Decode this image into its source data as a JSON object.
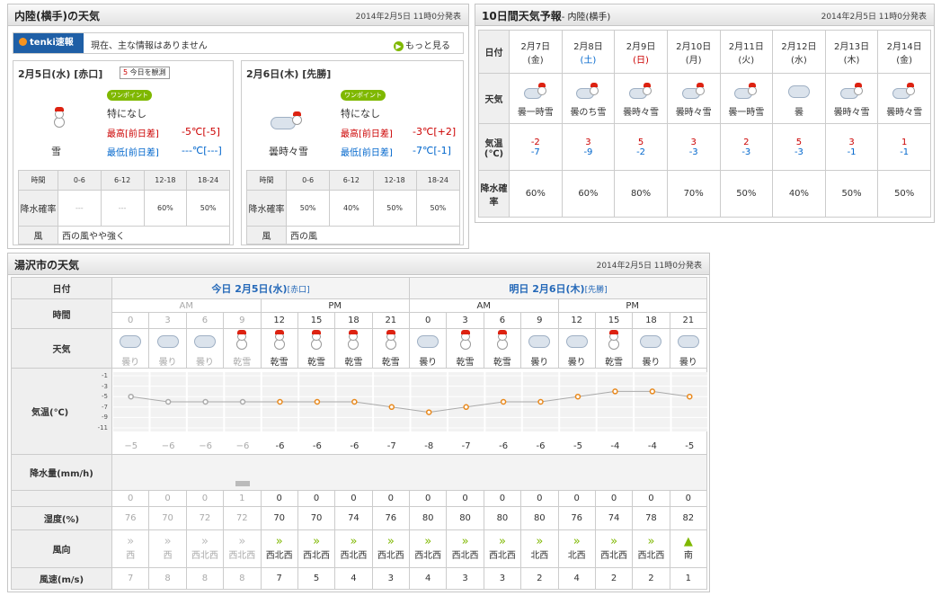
{
  "p1": {
    "title": "内陸(横手)の天気",
    "published": "2014年2月5日 11時0分発表",
    "badge": "tenki速報",
    "badge_msg": "現在、主な情報はありません",
    "more": "もっと見る",
    "days": [
      {
        "date": "2月5日(水) [赤口]",
        "tag": "今日を観測",
        "point": "ワンポイント",
        "note": "特になし",
        "weather": "雪",
        "icon": "snowman",
        "max_label": "最高[前日差]",
        "max": "-5℃[-5]",
        "min_label": "最低[前日差]",
        "min": "---℃[---]",
        "h_time": "時間",
        "slots": [
          "0-6",
          "6-12",
          "12-18",
          "18-24"
        ],
        "h_rain": "降水確率",
        "rain": [
          "---",
          "---",
          "60%",
          "50%"
        ],
        "h_wind": "風",
        "wind": "西の風やや強く"
      },
      {
        "date": "2月6日(木) [先勝]",
        "tag": "",
        "point": "ワンポイント",
        "note": "特になし",
        "weather": "曇時々雪",
        "icon": "cloud-snowman",
        "max_label": "最高[前日差]",
        "max": "-3℃[+2]",
        "min_label": "最低[前日差]",
        "min": "-7℃[-1]",
        "h_time": "時間",
        "slots": [
          "0-6",
          "6-12",
          "12-18",
          "18-24"
        ],
        "h_rain": "降水確率",
        "rain": [
          "50%",
          "40%",
          "50%",
          "50%"
        ],
        "h_wind": "風",
        "wind": "西の風"
      }
    ]
  },
  "p2": {
    "title": "10日間天気予報",
    "area": "- 内陸(横手)",
    "published": "2014年2月5日 11時0分発表",
    "labels": {
      "date": "日付",
      "weather": "天気",
      "temp": "気温(℃)",
      "rain": "降水確率"
    },
    "days": [
      {
        "d": "2月7日",
        "w": "(金)",
        "wc": "",
        "icon": "cloud-snowman",
        "weather": "曇一時雪",
        "hi": "-2",
        "lo": "-7",
        "rain": "60%"
      },
      {
        "d": "2月8日",
        "w": "(土)",
        "wc": "sat",
        "icon": "cloud-snowman",
        "weather": "曇のち雪",
        "hi": "3",
        "lo": "-9",
        "rain": "60%"
      },
      {
        "d": "2月9日",
        "w": "(日)",
        "wc": "sun",
        "icon": "cloud-snowman",
        "weather": "曇時々雪",
        "hi": "5",
        "lo": "-2",
        "rain": "80%"
      },
      {
        "d": "2月10日",
        "w": "(月)",
        "wc": "",
        "icon": "cloud-snowman",
        "weather": "曇時々雪",
        "hi": "3",
        "lo": "-3",
        "rain": "70%"
      },
      {
        "d": "2月11日",
        "w": "(火)",
        "wc": "",
        "icon": "cloud-snowman",
        "weather": "曇一時雪",
        "hi": "2",
        "lo": "-3",
        "rain": "50%"
      },
      {
        "d": "2月12日",
        "w": "(水)",
        "wc": "",
        "icon": "cloud",
        "weather": "曇",
        "hi": "5",
        "lo": "-3",
        "rain": "40%"
      },
      {
        "d": "2月13日",
        "w": "(木)",
        "wc": "",
        "icon": "cloud-snowman",
        "weather": "曇時々雪",
        "hi": "3",
        "lo": "-1",
        "rain": "50%"
      },
      {
        "d": "2月14日",
        "w": "(金)",
        "wc": "",
        "icon": "cloud-snowman",
        "weather": "曇時々雪",
        "hi": "1",
        "lo": "-1",
        "rain": "50%"
      }
    ]
  },
  "p3": {
    "title": "湯沢市の天気",
    "published": "2014年2月5日 11時0分発表",
    "labels": {
      "date": "日付",
      "time": "時間",
      "weather": "天気",
      "temp": "気温(℃)",
      "precip": "降水量(mm/h)",
      "humidity": "湿度(%)",
      "wind_dir": "風向",
      "wind_speed": "風速(m/s)"
    },
    "today": "今日 2月5日(水)",
    "today_r": "[赤口]",
    "tomorrow": "明日 2月6日(木)",
    "tomorrow_r": "[先勝]",
    "am": "AM",
    "pm": "PM",
    "yticks": [
      "-1",
      "-3",
      "-5",
      "-7",
      "-9",
      "-11"
    ],
    "hours": [
      "0",
      "3",
      "6",
      "9",
      "12",
      "15",
      "18",
      "21",
      "0",
      "3",
      "6",
      "9",
      "12",
      "15",
      "18",
      "21"
    ],
    "weather": [
      "曇り",
      "曇り",
      "曇り",
      "乾雪",
      "乾雪",
      "乾雪",
      "乾雪",
      "乾雪",
      "曇り",
      "乾雪",
      "乾雪",
      "曇り",
      "曇り",
      "乾雪",
      "曇り",
      "曇り"
    ],
    "icons": [
      "cloud",
      "cloud",
      "cloud",
      "snowman",
      "snowman",
      "snowman",
      "snowman",
      "snowman",
      "cloud",
      "snowman",
      "snowman",
      "cloud",
      "cloud",
      "snowman",
      "cloud",
      "cloud"
    ],
    "precip": [
      "0",
      "0",
      "0",
      "1",
      "0",
      "0",
      "0",
      "0",
      "0",
      "0",
      "0",
      "0",
      "0",
      "0",
      "0",
      "0"
    ],
    "humidity": [
      "76",
      "70",
      "72",
      "72",
      "70",
      "70",
      "74",
      "76",
      "80",
      "80",
      "80",
      "80",
      "76",
      "74",
      "78",
      "82"
    ],
    "wind_dir": [
      "西",
      "西",
      "西北西",
      "西北西",
      "西北西",
      "西北西",
      "西北西",
      "西北西",
      "西北西",
      "西北西",
      "西北西",
      "北西",
      "北西",
      "西北西",
      "西北西",
      "南"
    ],
    "wind_speed": [
      "7",
      "8",
      "8",
      "8",
      "7",
      "5",
      "4",
      "3",
      "4",
      "3",
      "3",
      "2",
      "4",
      "2",
      "2",
      "1"
    ],
    "temp_labels": [
      "−5",
      "−6",
      "−6",
      "−6",
      "-6",
      "-6",
      "-6",
      "-7",
      "-8",
      "-7",
      "-6",
      "-6",
      "-5",
      "-4",
      "-4",
      "-5"
    ]
  },
  "chart_data": {
    "type": "line",
    "title": "",
    "xlabel": "",
    "ylabel": "気温(℃)",
    "categories": [
      "0",
      "3",
      "6",
      "9",
      "12",
      "15",
      "18",
      "21",
      "0",
      "3",
      "6",
      "9",
      "12",
      "15",
      "18",
      "21"
    ],
    "values": [
      -5,
      -6,
      -6,
      -6,
      -6,
      -6,
      -6,
      -7,
      -8,
      -7,
      -6,
      -6,
      -5,
      -4,
      -4,
      -5
    ],
    "ylim": [
      -11,
      -1
    ],
    "grid": true
  },
  "colors": {
    "accent": "#e8891d",
    "link": "#2468b8",
    "green": "#7fb800"
  }
}
